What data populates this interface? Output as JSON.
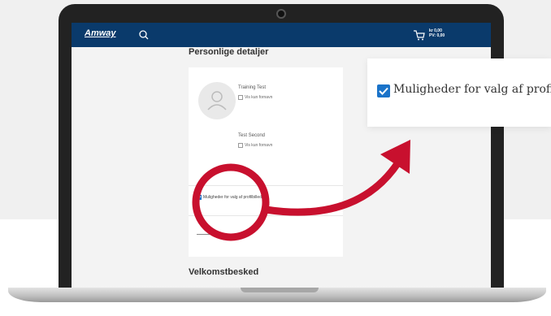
{
  "navbar": {
    "logo": "Amway",
    "cart_amount": "kr 0,00",
    "cart_pv": "PV: 0,00"
  },
  "profile": {
    "title": "Personlige detaljer",
    "people": [
      {
        "name": "Training Test",
        "option": "Vis kun fornavn"
      },
      {
        "name": "Test Second",
        "option": "Vis kun fornavn"
      }
    ],
    "privacy_option": "Muligheder for valg af profilbillede"
  },
  "welcome": {
    "title": "Velkomstbesked"
  },
  "zoom": {
    "label": "Muligheder for valg af profilbillede"
  },
  "colors": {
    "navbar": "#0a3a6b",
    "accent_check": "#1a73c9",
    "highlight": "#c8102e"
  }
}
